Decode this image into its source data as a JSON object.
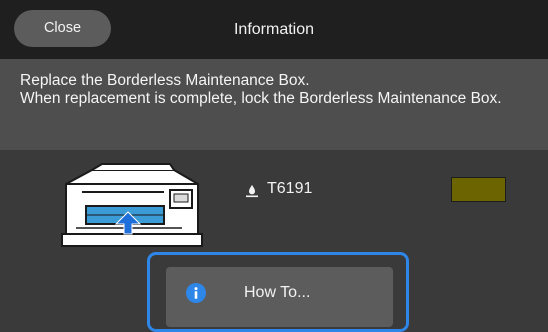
{
  "header": {
    "close_label": "Close",
    "title": "Information"
  },
  "message": {
    "text": "Replace the Borderless Maintenance Box.\nWhen replacement is complete, lock the Borderless Maintenance Box."
  },
  "status": {
    "ink_code": "T6191",
    "swatch_color": "#6b6400"
  },
  "actions": {
    "howto_label": "How To..."
  },
  "colors": {
    "header_bg": "#1f1f1f",
    "message_bg": "#4e4e4e",
    "body_bg": "#3a3a3a",
    "button_bg": "#5c5c5c",
    "focus": "#2f86e9",
    "arrow": "#1e6fd9"
  },
  "icons": {
    "ink": "ink-drop-icon",
    "info": "info-icon",
    "printer": "printer-illustration"
  }
}
